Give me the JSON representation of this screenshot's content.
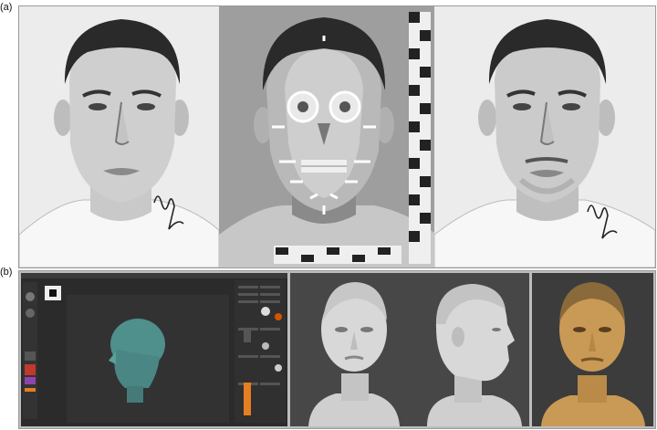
{
  "figure": {
    "label_a": "(a)",
    "label_b": "(b)"
  },
  "colors": {
    "sketch_bg": "#efefef",
    "xray_bg": "#9e9e9e",
    "software_bg": "#2b2b2b",
    "render_bg": "#4a4a4a",
    "clay_head": "#d8d8d8",
    "painted_head": "#c99a55",
    "model_head": "#4f8f8c"
  },
  "icons": {
    "scale_ruler": "scale-ruler-icon",
    "signature": "signature-icon"
  }
}
